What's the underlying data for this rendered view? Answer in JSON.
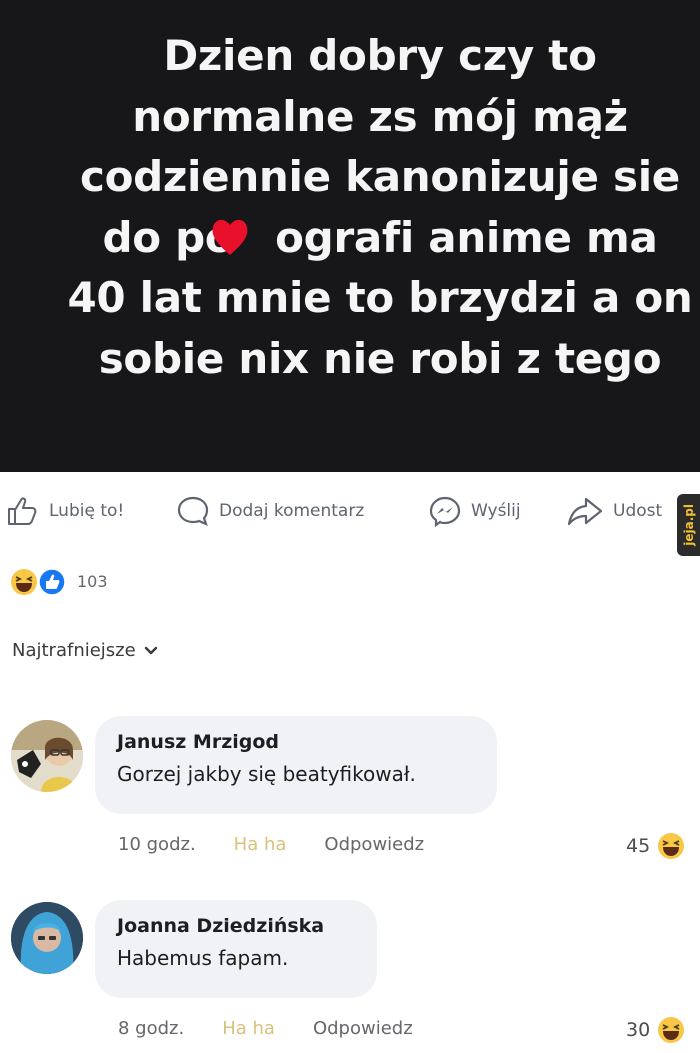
{
  "post": {
    "lines": [
      "Dzien dobry czy to",
      "normalne zs mój mąż",
      "codziennie kanonizuje sie",
      "do po ografi anime ma",
      "40 lat mnie to brzydzi a on",
      "sobie nix nie robi z tego"
    ]
  },
  "actions": {
    "like": {
      "label": "Lubię to!",
      "icon": "thumbs-up-icon"
    },
    "comment": {
      "label": "Dodaj komentarz",
      "icon": "comment-icon"
    },
    "send": {
      "label": "Wyślij",
      "icon": "messenger-icon"
    },
    "share": {
      "label": "Udost",
      "icon": "share-arrow-icon"
    }
  },
  "watermark": {
    "text": "jeja.pl"
  },
  "reactions": {
    "count": "103",
    "icons": [
      "haha-emoji-icon",
      "like-reaction-icon"
    ]
  },
  "sort": {
    "label": "Najtrafniejsze",
    "icon": "chevron-down-icon"
  },
  "comments": [
    {
      "author": "Janusz Mrzigod",
      "text": "Gorzej jakby się beatyfikował.",
      "time": "10 godz.",
      "haha": "Ha ha",
      "reply": "Odpowiedz",
      "reaction_count": "45"
    },
    {
      "author": "Joanna Dziedzińska",
      "text": "Habemus fapam.",
      "time": "8 godz.",
      "haha": "Ha ha",
      "reply": "Odpowiedz",
      "reaction_count": "30"
    }
  ],
  "colors": {
    "post_background": "#17171a",
    "post_text": "#f5f5f5",
    "sticker": "#e8102a",
    "bubble": "#f0f2f5",
    "meta": "#65676b",
    "haha_label": "#d8c27c",
    "like_blue": "#1877f2",
    "haha_yellow": "#f7c745"
  }
}
